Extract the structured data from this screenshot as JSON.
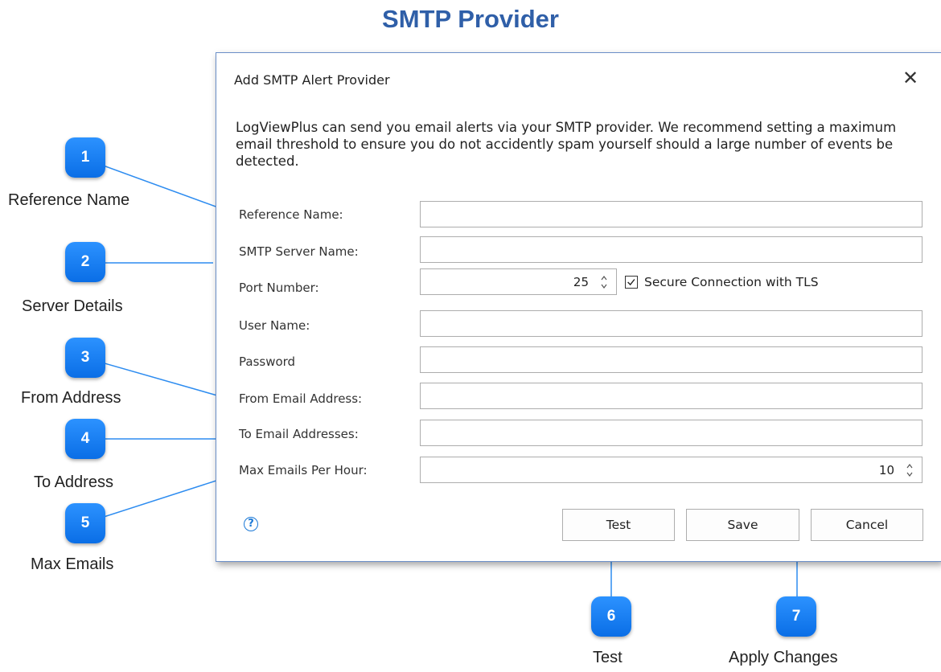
{
  "page": {
    "title": "SMTP Provider"
  },
  "dialog": {
    "title": "Add SMTP Alert Provider",
    "intro": "LogViewPlus can send you email alerts via your SMTP provider.  We recommend setting a maximum email threshold to ensure you do not accidently spam yourself should a large number of events be detected.",
    "fields": {
      "reference_name": {
        "label": "Reference Name:",
        "value": ""
      },
      "smtp_server": {
        "label": "SMTP Server Name:",
        "value": ""
      },
      "port": {
        "label": "Port Number:",
        "value": "25"
      },
      "user_name": {
        "label": "User Name:",
        "value": ""
      },
      "password": {
        "label": "Password",
        "value": ""
      },
      "from_email": {
        "label": "From Email Address:",
        "value": ""
      },
      "to_emails": {
        "label": "To Email Addresses:",
        "value": ""
      },
      "max_emails": {
        "label": "Max Emails Per Hour:",
        "value": "10"
      }
    },
    "tls": {
      "label": "Secure Connection with TLS",
      "checked": true
    },
    "buttons": {
      "test": "Test",
      "save": "Save",
      "cancel": "Cancel"
    }
  },
  "callouts": [
    {
      "number": "1",
      "label": "Reference Name"
    },
    {
      "number": "2",
      "label": "Server Details"
    },
    {
      "number": "3",
      "label": "From Address"
    },
    {
      "number": "4",
      "label": "To Address"
    },
    {
      "number": "5",
      "label": "Max Emails"
    },
    {
      "number": "6",
      "label": "Test"
    },
    {
      "number": "7",
      "label": "Apply Changes"
    }
  ],
  "colors": {
    "title": "#2f5fa8",
    "badge": "#1a80f5",
    "callout_line": "#2d8cf0"
  },
  "icons": {
    "close": "close-icon",
    "help": "help-icon",
    "spinner": "spinner-icon",
    "check": "check-icon"
  }
}
